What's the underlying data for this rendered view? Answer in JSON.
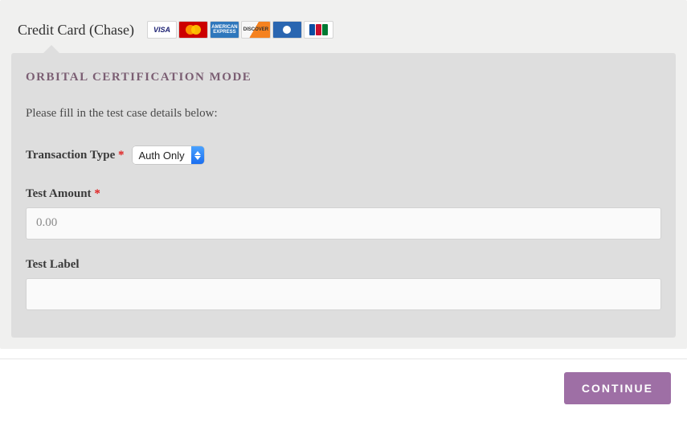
{
  "header": {
    "title": "Credit Card (Chase)",
    "card_icons": [
      "visa",
      "mastercard",
      "amex",
      "discover",
      "diners",
      "jcb"
    ]
  },
  "panel": {
    "mode_title": "ORBITAL CERTIFICATION MODE",
    "instruction": "Please fill in the test case details below:",
    "fields": {
      "transaction_type": {
        "label": "Transaction Type",
        "required": true,
        "selected": "Auth Only"
      },
      "test_amount": {
        "label": "Test Amount",
        "required": true,
        "value": "0.00"
      },
      "test_label": {
        "label": "Test Label",
        "required": false,
        "value": ""
      }
    }
  },
  "footer": {
    "continue_label": "CONTINUE"
  },
  "required_marker": "*"
}
